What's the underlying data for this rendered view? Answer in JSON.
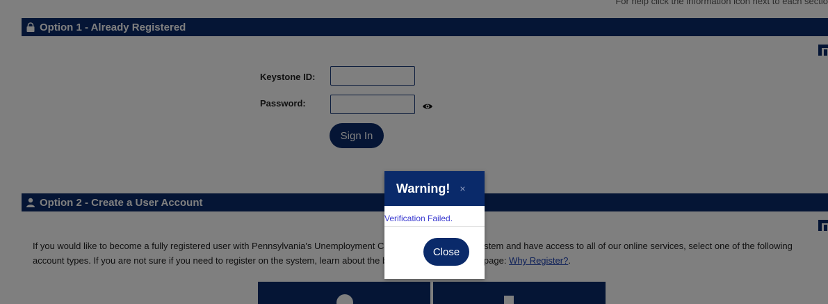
{
  "help_text": "For help click the information icon next to each sectio",
  "option1": {
    "title": "Option 1 - Already Registered",
    "keystone_label": "Keystone ID:",
    "keystone_value": "",
    "password_label": "Password:",
    "password_value": "",
    "signin_label": "Sign In",
    "icon": "lock-icon"
  },
  "option2": {
    "title": "Option 2 - Create a User Account",
    "icon": "user-icon",
    "description_part1": "If you would like to become a fully registered user with Pennsylvania's Unemployment Compensation Benefits System and have access to all of our online services, select one of the following account types. If you are not sure if you need to register on the system, learn about the benefits of registering on page: ",
    "why_register_link": "Why Register?",
    "description_end": "."
  },
  "dialog": {
    "title": "Warning!",
    "close_x": "×",
    "message": "Verification Failed.",
    "close_label": "Close"
  },
  "colors": {
    "brand_navy": "#0a2a6a",
    "message_text": "#3a3ad0",
    "overlay": "rgba(0,0,0,0.5)"
  }
}
